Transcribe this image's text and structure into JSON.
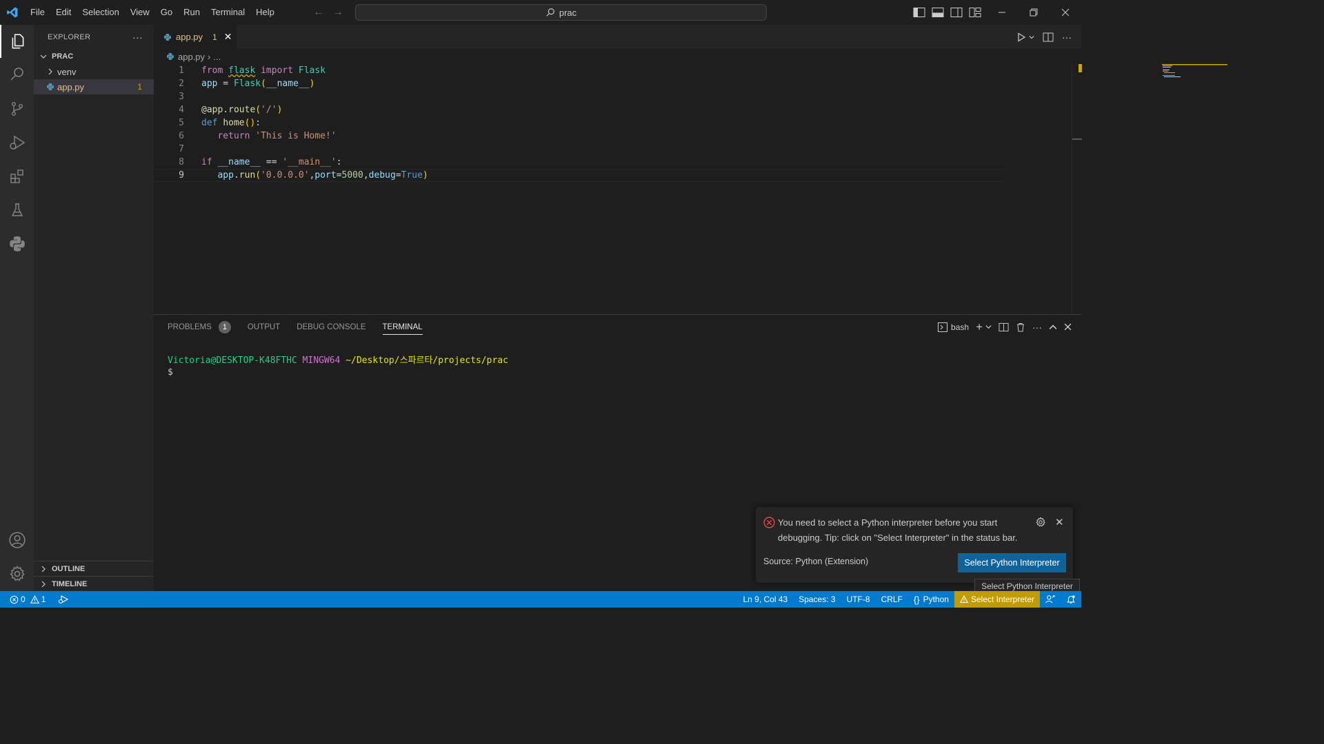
{
  "titlebar": {
    "menu": [
      "File",
      "Edit",
      "Selection",
      "View",
      "Go",
      "Run",
      "Terminal",
      "Help"
    ],
    "search_text": "prac"
  },
  "activitybar": {
    "icons": [
      "explorer-icon",
      "search-icon",
      "source-control-icon",
      "run-debug-icon",
      "extensions-icon",
      "testing-icon",
      "python-icon",
      "account-icon",
      "settings-gear-icon"
    ]
  },
  "sidebar": {
    "title": "EXPLORER",
    "more": "···",
    "root_folder": "PRAC",
    "items": [
      {
        "label": "venv",
        "type": "folder"
      },
      {
        "label": "app.py",
        "type": "file",
        "problems": "1"
      }
    ],
    "outline": "OUTLINE",
    "timeline": "TIMELINE"
  },
  "editor": {
    "tab": {
      "label": "app.py",
      "problems": "1"
    },
    "breadcrumb": {
      "file": "app.py",
      "rest": "..."
    },
    "current_line": 9,
    "line_numbers": [
      "1",
      "2",
      "3",
      "4",
      "5",
      "6",
      "7",
      "8",
      "9"
    ],
    "code_lines": [
      "from flask import Flask",
      "app = Flask(__name__)",
      "",
      "@app.route('/')",
      "def home():",
      "    return 'This is Home!'",
      "",
      "if __name__ == '__main__':",
      "    app.run('0.0.0.0',port=5000,debug=True)"
    ]
  },
  "panel": {
    "tabs": [
      {
        "label": "PROBLEMS",
        "badge": "1"
      },
      {
        "label": "OUTPUT"
      },
      {
        "label": "DEBUG CONSOLE"
      },
      {
        "label": "TERMINAL",
        "active": true
      }
    ],
    "shell": "bash",
    "terminal": {
      "user_host": "Victoria@DESKTOP-K48FTHC",
      "system": "MINGW64",
      "path": "~/Desktop/스파르타/projects/prac",
      "prompt": "$"
    }
  },
  "notification": {
    "message": "You need to select a Python interpreter before you start debugging. Tip: click on \"Select Interpreter\" in the status bar.",
    "source": "Source: Python (Extension)",
    "button": "Select Python Interpreter"
  },
  "tooltip": "Select Python Interpreter",
  "statusbar": {
    "errors": "0",
    "warnings": "1",
    "position": "Ln 9, Col 43",
    "spaces": "Spaces: 3",
    "encoding": "UTF-8",
    "eol": "CRLF",
    "language": "Python",
    "interpreter": "Select Interpreter"
  },
  "colors": {
    "accent": "#007acc",
    "warning": "#cca700",
    "button": "#0e639c"
  }
}
